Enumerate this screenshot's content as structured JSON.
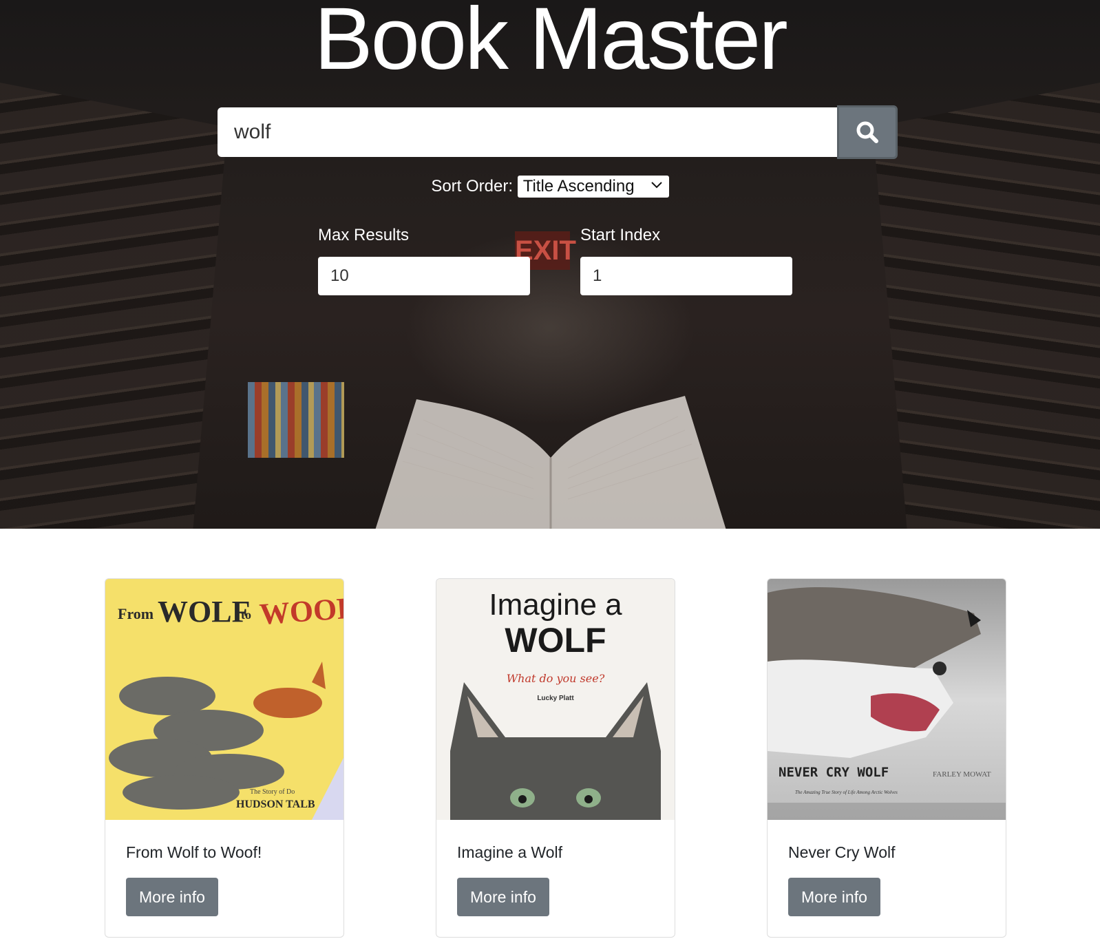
{
  "app": {
    "title": "Book Master"
  },
  "search": {
    "value": "wolf",
    "button_icon": "search-icon"
  },
  "sort": {
    "label": "Sort Order:",
    "selected": "Title Ascending"
  },
  "max_results": {
    "label": "Max Results",
    "value": "10"
  },
  "start_index": {
    "label": "Start Index",
    "value": "1"
  },
  "results": [
    {
      "title": "From Wolf to Woof!",
      "button": "More info",
      "cover": {
        "line1_small": "From",
        "line1_big": "WOLF",
        "line1_to": "to",
        "line1_red": "WOOF!",
        "subtitle": "The Story of Do",
        "author": "HUDSON TALB"
      }
    },
    {
      "title": "Imagine a Wolf",
      "button": "More info",
      "cover": {
        "line1": "Imagine a",
        "line2": "WOLF",
        "tagline": "What do you see?",
        "author": "Lucky Platt"
      }
    },
    {
      "title": "Never Cry Wolf",
      "button": "More info",
      "cover": {
        "title": "NEVER CRY WOLF",
        "author": "FARLEY MOWAT",
        "tagline": "The Amazing True Story of Life Among Arctic Wolves"
      }
    }
  ],
  "colors": {
    "button_gray": "#6c757d",
    "hero_dark": "#1f1a18"
  }
}
